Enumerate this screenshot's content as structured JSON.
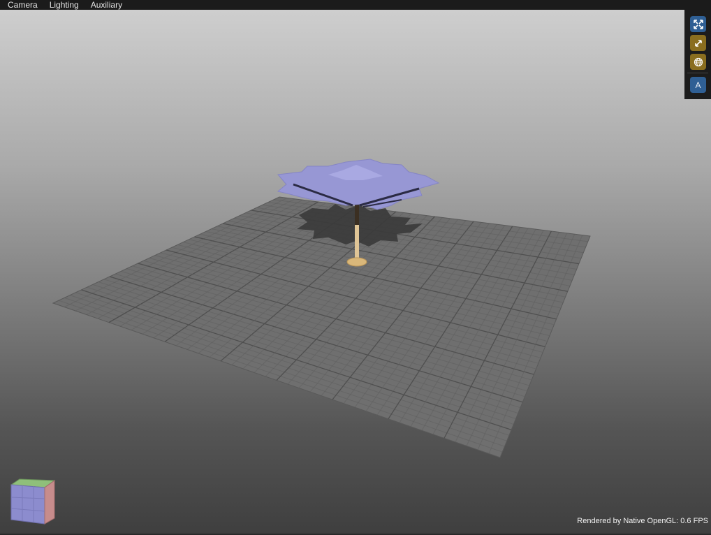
{
  "menu": {
    "items": [
      "Camera",
      "Lighting",
      "Auxiliary"
    ]
  },
  "toolbar": {
    "buttons": [
      {
        "icon": "fullscreen-icon",
        "color": "#2f5f94"
      },
      {
        "icon": "resize-arrows-icon",
        "color": "#8a6e1f"
      },
      {
        "icon": "globe-icon",
        "color": "#8a6e1f"
      },
      {
        "icon": "letter-a-icon",
        "label": "A",
        "color": "#2f5f94"
      }
    ]
  },
  "scene": {
    "objects": [
      "ground-grid",
      "umbrella-canopy",
      "umbrella-pole",
      "umbrella-base",
      "umbrella-shadow"
    ],
    "canopy_color": "#9a9ad6",
    "pole_color": "#e2c89a",
    "grid_color": "#6e6e6e"
  },
  "status": {
    "text": "Rendered by Native OpenGL: 0.6 FPS"
  }
}
